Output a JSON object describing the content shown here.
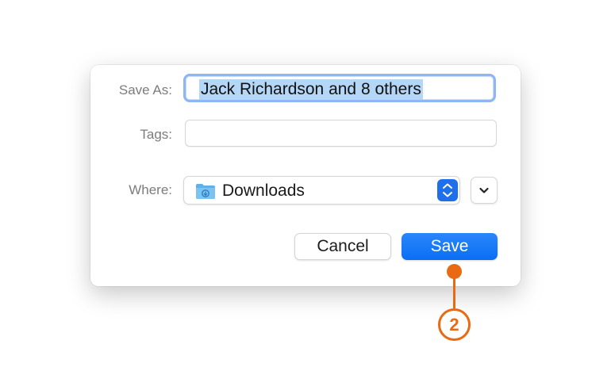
{
  "dialog": {
    "save_as": {
      "label": "Save As:",
      "value": "Jack Richardson and 8 others",
      "selected": true
    },
    "tags": {
      "label": "Tags:",
      "value": ""
    },
    "where": {
      "label": "Where:",
      "selected": "Downloads",
      "icon": "downloads-folder-icon",
      "stepper_icon": "updown-chevron-icon"
    },
    "expand_icon": "chevron-down-icon",
    "buttons": {
      "cancel": "Cancel",
      "save": "Save"
    }
  },
  "callout": {
    "number": "2",
    "color": "#ea6a14"
  },
  "colors": {
    "accent": "#0a6ef4",
    "selection": "#b4d6f7",
    "focus_ring": "#8fb6f4"
  }
}
